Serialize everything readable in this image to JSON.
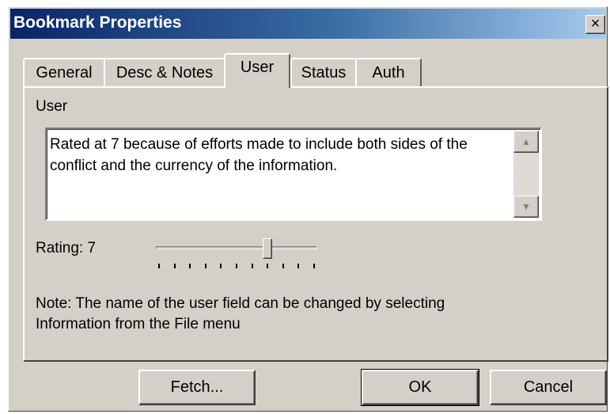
{
  "window": {
    "title": "Bookmark Properties",
    "close_glyph": "×"
  },
  "tabs": [
    {
      "label": "General",
      "active": false
    },
    {
      "label": "Desc & Notes",
      "active": false
    },
    {
      "label": "User",
      "active": true
    },
    {
      "label": "Status",
      "active": false
    },
    {
      "label": "Auth",
      "active": false
    }
  ],
  "user_panel": {
    "field_label": "User",
    "field_value": "Rated at 7 because of efforts made to include both sides of the conflict and the currency of the information.",
    "rating_label": "Rating: 7",
    "rating": {
      "value": 7,
      "min": 0,
      "max": 10
    },
    "note_line1": "Note: The name of the user field can be changed by selecting",
    "note_line2": "Information from the File menu"
  },
  "buttons": {
    "fetch": "Fetch...",
    "ok": "OK",
    "cancel": "Cancel"
  },
  "icons": {
    "scroll_up": "up-arrow-icon",
    "scroll_down": "down-arrow-icon",
    "close": "close-icon"
  },
  "colors": {
    "face": "#d4d0c8",
    "title_start": "#0a246a",
    "title_end": "#a6caf0"
  }
}
